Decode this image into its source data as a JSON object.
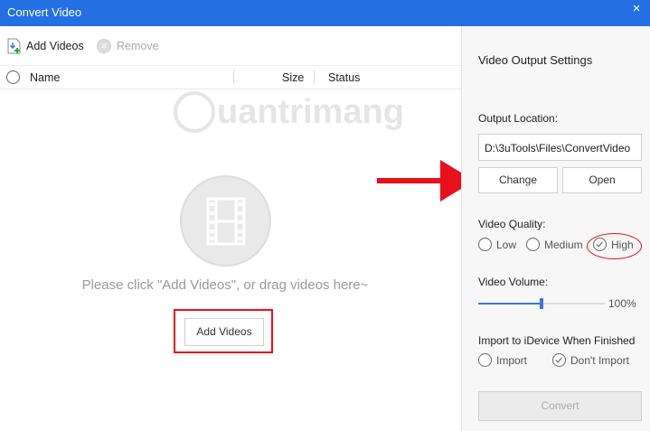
{
  "window": {
    "title": "Convert Video",
    "close_icon": "×"
  },
  "toolbar": {
    "add_videos": "Add Videos",
    "remove": "Remove"
  },
  "table": {
    "columns": {
      "name": "Name",
      "size": "Size",
      "status": "Status"
    }
  },
  "empty": {
    "hint": "Please click \"Add Videos\", or drag videos here~",
    "add_button": "Add Videos"
  },
  "watermark": "uantrimang",
  "settings": {
    "heading": "Video Output Settings",
    "output_location_label": "Output Location:",
    "output_location_value": "D:\\3uTools\\Files\\ConvertVideo",
    "change": "Change",
    "open": "Open",
    "quality_label": "Video Quality:",
    "quality_options": [
      "Low",
      "Medium",
      "High"
    ],
    "quality_selected": "High",
    "volume_label": "Video Volume:",
    "volume_value": "100%",
    "volume_slider_fraction": 0.5,
    "import_label": "Import to iDevice When Finished",
    "import_options": [
      "Import",
      "Don't Import"
    ],
    "import_selected": "Don't Import",
    "convert": "Convert"
  },
  "colors": {
    "titlebar": "#2470e3",
    "annotation": "#e8101a",
    "slider": "#3a78d8"
  }
}
